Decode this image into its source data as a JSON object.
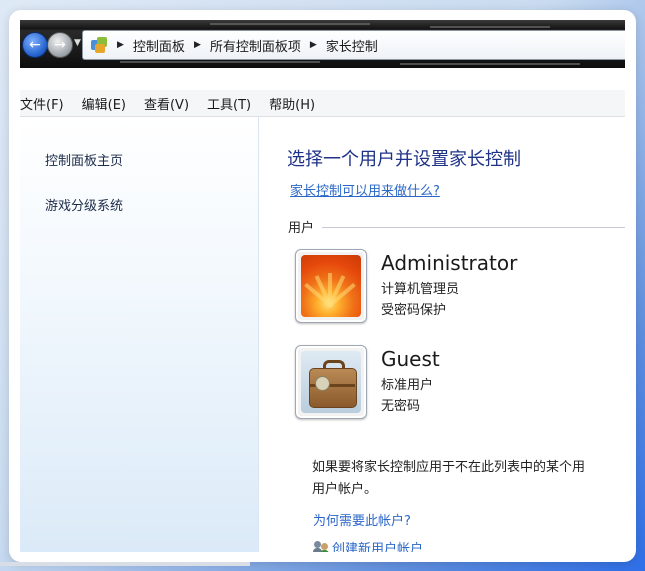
{
  "window": {
    "breadcrumbs": [
      "控制面板",
      "所有控制面板项",
      "家长控制"
    ]
  },
  "menu": {
    "items": [
      "文件(F)",
      "编辑(E)",
      "查看(V)",
      "工具(T)",
      "帮助(H)"
    ]
  },
  "sidebar": {
    "items": [
      "控制面板主页",
      "游戏分级系统"
    ]
  },
  "main": {
    "title": "选择一个用户并设置家长控制",
    "help_link": "家长控制可以用来做什么?",
    "section_label": "用户",
    "users": [
      {
        "name": "Administrator",
        "role": "计算机管理员",
        "status": "受密码保护",
        "picture": "flower-picture"
      },
      {
        "name": "Guest",
        "role": "标准用户",
        "status": "无密码",
        "picture": "suitcase-picture"
      }
    ],
    "note": "如果要将家长控制应用于不在此列表中的某个用户帐户。",
    "note_line1": "如果要将家长控制应用于不在此列表中的某个用",
    "note_line2": "用户帐户。",
    "why_link": "为何需要此帐户?",
    "create_link": "创建新用户帐户"
  },
  "icons": {
    "back": "back-arrow-icon",
    "forward": "forward-arrow-icon",
    "address": "control-panel-icon",
    "create": "users-icon"
  },
  "colors": {
    "link": "#2a67c8",
    "title": "#1e3287"
  }
}
